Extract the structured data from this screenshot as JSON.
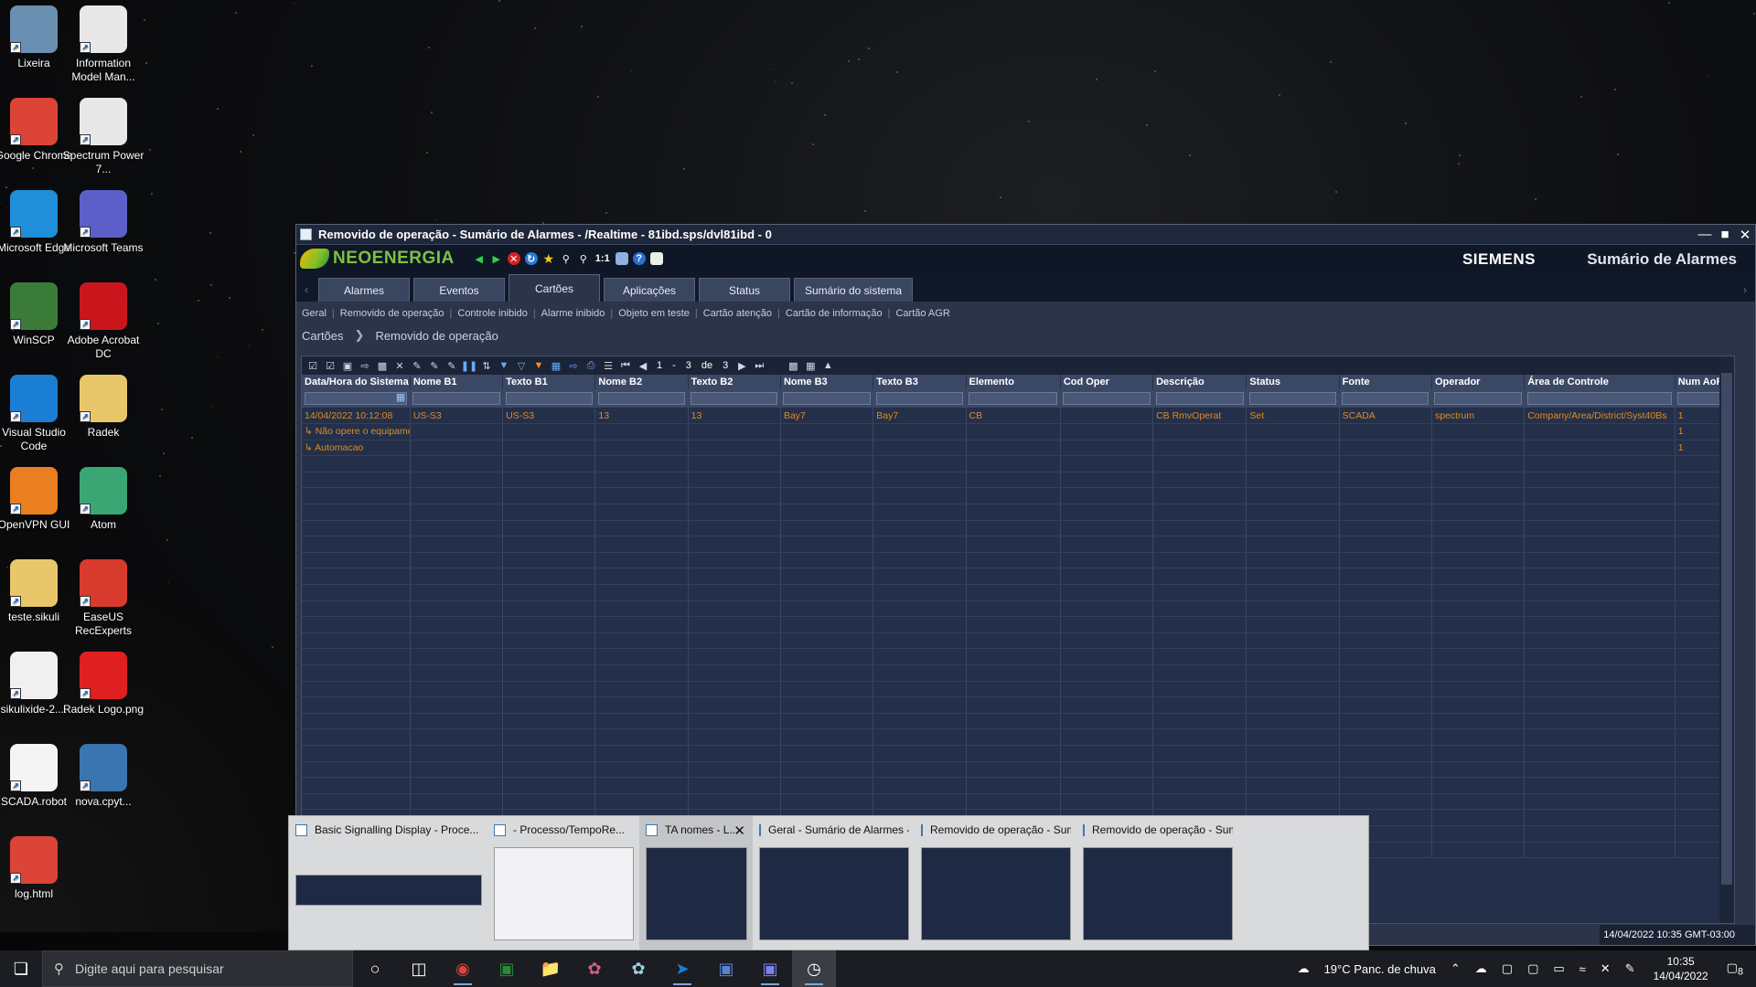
{
  "desktop": {
    "icons": [
      {
        "label": "Lixeira",
        "icon": "recycle-bin-icon",
        "color": "#6a8fb0"
      },
      {
        "label": "Information Model Man...",
        "icon": "spectrum-7-icon",
        "color": "#e8e8e8"
      },
      {
        "label": "Google Chrome",
        "icon": "chrome-icon",
        "color": "#db4437"
      },
      {
        "label": "Spectrum Power 7...",
        "icon": "spectrum-7-icon",
        "color": "#e8e8e8"
      },
      {
        "label": "Microsoft Edge",
        "icon": "edge-icon",
        "color": "#1e8fd8"
      },
      {
        "label": "Microsoft Teams",
        "icon": "teams-icon",
        "color": "#5b5fc7"
      },
      {
        "label": "WinSCP",
        "icon": "winscp-icon",
        "color": "#3b7b3a"
      },
      {
        "label": "Adobe Acrobat DC",
        "icon": "acrobat-icon",
        "color": "#c9161d"
      },
      {
        "label": "Visual Studio Code",
        "icon": "vscode-icon",
        "color": "#1a7fd4"
      },
      {
        "label": "Radek",
        "icon": "folder-icon",
        "color": "#e8c76a"
      },
      {
        "label": "OpenVPN GUI",
        "icon": "openvpn-icon",
        "color": "#ea7e20"
      },
      {
        "label": "Atom",
        "icon": "atom-icon",
        "color": "#3aa674"
      },
      {
        "label": "teste.sikuli",
        "icon": "folder-icon",
        "color": "#e8c76a"
      },
      {
        "label": "EaseUS RecExperts",
        "icon": "easeus-icon",
        "color": "#d83a2e"
      },
      {
        "label": "sikulixide-2....",
        "icon": "java-icon",
        "color": "#f0f0f0"
      },
      {
        "label": "Radek Logo.png",
        "icon": "image-icon",
        "color": "#e02020"
      },
      {
        "label": "SCADA.robot",
        "icon": "text-file-icon",
        "color": "#f4f4f4"
      },
      {
        "label": "nova.cpyt...",
        "icon": "python-icon",
        "color": "#3a75b0"
      },
      {
        "label": "log.html",
        "icon": "chrome-icon",
        "color": "#db4437"
      }
    ]
  },
  "window": {
    "title": "Removido de operação - Sumário de Alarmes - /Realtime - 81ibd.sps/dvl81ibd - 0",
    "logo_text": "NEOENERGIA",
    "brand": "SIEMENS",
    "app_title": "Sumário de Alarmes",
    "zoom_label": "1:1",
    "tabs": [
      "Alarmes",
      "Eventos",
      "Cartões",
      "Aplicações",
      "Status",
      "Sumário do sistema"
    ],
    "active_tab": "Cartões",
    "subnav": [
      "Geral",
      "Removido de operação",
      "Controle inibido",
      "Alarme inibido",
      "Objeto em teste",
      "Cartão atenção",
      "Cartão de informação",
      "Cartão AGR"
    ],
    "breadcrumb": [
      "Cartões",
      "Removido de operação"
    ],
    "pager": {
      "current": "1",
      "dash": "-",
      "last_shown": "3",
      "of_label": "de",
      "total": "3"
    },
    "columns": [
      "Data/Hora do Sistema",
      "Nome B1",
      "Texto B1",
      "Nome B2",
      "Texto B2",
      "Nome B3",
      "Texto B3",
      "Elemento",
      "Cod Oper",
      "Descrição",
      "Status",
      "Fonte",
      "Operador",
      "Área de Controle",
      "Num AoR"
    ],
    "rows": [
      {
        "cells": [
          "14/04/2022 10:12:08",
          "US-S3",
          "US-S3",
          "13",
          "13",
          "Bay7",
          "Bay7",
          "CB",
          "",
          "CB      RmvOperat",
          "Set",
          "SCADA",
          "spectrum",
          "Company/Area/District/Syst40Bs",
          "1"
        ]
      },
      {
        "cells": [
          "↳ Não opere o equipamento",
          "",
          "",
          "",
          "",
          "",
          "",
          "",
          "",
          "",
          "",
          "",
          "",
          "",
          "1"
        ]
      },
      {
        "cells": [
          "↳ Automacao",
          "",
          "",
          "",
          "",
          "",
          "",
          "",
          "",
          "",
          "",
          "",
          "",
          "",
          "1"
        ]
      }
    ],
    "status_time": "14/04/2022 10:35 GMT-03:00"
  },
  "thumbnails": [
    {
      "title": "Basic Signalling Display - Proce..."
    },
    {
      "title": "- Processo/TempoRe..."
    },
    {
      "title": "TA nomes - L..."
    },
    {
      "title": "Geral - Sumário de Alarmes - /R..."
    },
    {
      "title": "Removido de operação - Sumár..."
    },
    {
      "title": "Removido de operação - Sumár..."
    }
  ],
  "taskbar": {
    "search_placeholder": "Digite aqui para pesquisar",
    "weather": "19°C  Panc. de chuva",
    "time": "10:35",
    "date": "14/04/2022",
    "notification_count": "8"
  },
  "colors": {
    "alarm_text": "#e08a1f",
    "grid_bg": "#24304a",
    "header_bg": "#3b4865",
    "brand_green": "#7cc242"
  }
}
